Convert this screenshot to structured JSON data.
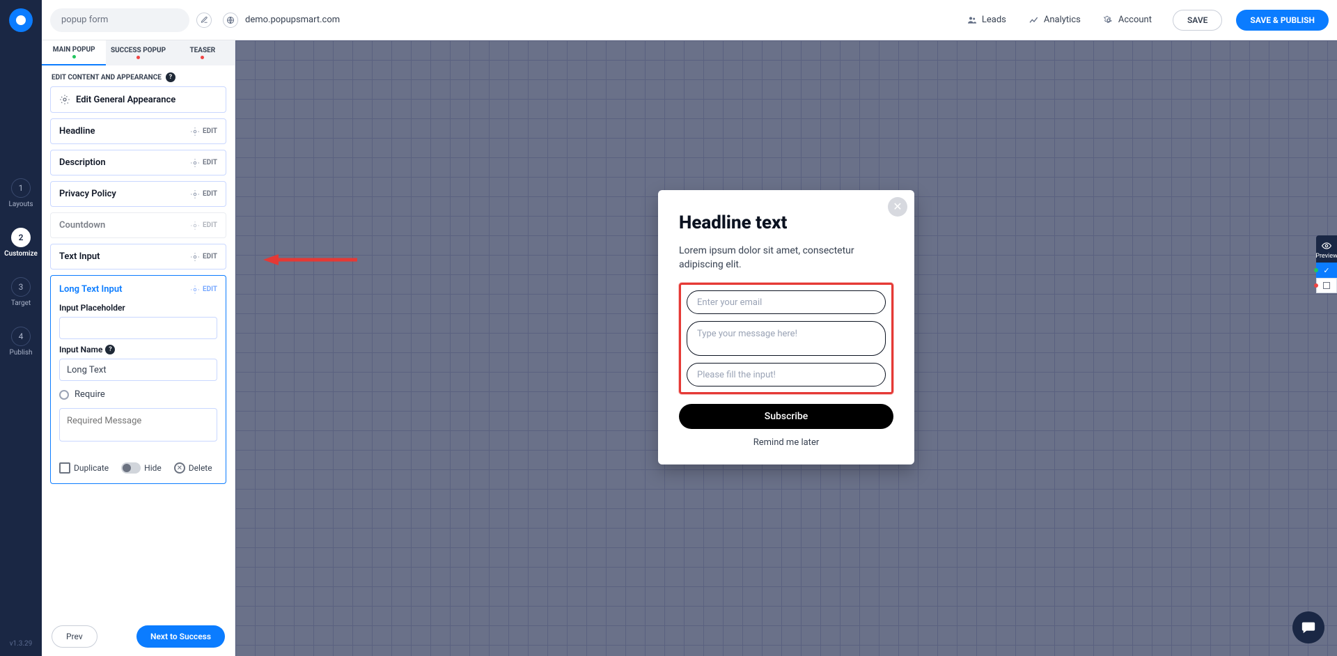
{
  "top": {
    "search_value": "popup form",
    "domain": "demo.popupsmart.com",
    "leads": "Leads",
    "analytics": "Analytics",
    "account": "Account",
    "save": "SAVE",
    "publish": "SAVE & PUBLISH"
  },
  "steps": {
    "s1": {
      "num": "1",
      "label": "Layouts"
    },
    "s2": {
      "num": "2",
      "label": "Customize"
    },
    "s3": {
      "num": "3",
      "label": "Target"
    },
    "s4": {
      "num": "4",
      "label": "Publish"
    }
  },
  "version": "v1.3.29",
  "tabs": {
    "main": "MAIN POPUP",
    "success": "SUCCESS POPUP",
    "teaser": "TEASER"
  },
  "panel": {
    "subtitle": "EDIT CONTENT AND APPEARANCE",
    "general": "Edit General Appearance",
    "edit": "EDIT",
    "rows": {
      "headline": "Headline",
      "description": "Description",
      "privacy": "Privacy Policy",
      "countdown": "Countdown",
      "textinput": "Text Input",
      "longtext": "Long Text Input"
    },
    "form": {
      "placeholder_label": "Input Placeholder",
      "placeholder_value": "",
      "name_label": "Input Name",
      "name_value": "Long Text",
      "require_label": "Require",
      "required_msg_placeholder": "Required Message"
    },
    "actions": {
      "duplicate": "Duplicate",
      "hide": "Hide",
      "delete": "Delete"
    },
    "footer": {
      "prev": "Prev",
      "next": "Next to Success"
    }
  },
  "popup": {
    "headline": "Headline text",
    "description": "Lorem ipsum dolor sit amet, consectetur adipiscing elit.",
    "email_ph": "Enter your email",
    "msg_ph": "Type your message here!",
    "fill_ph": "Please fill the input!",
    "subscribe": "Subscribe",
    "remind": "Remind me later"
  },
  "preview": {
    "label": "Preview"
  }
}
